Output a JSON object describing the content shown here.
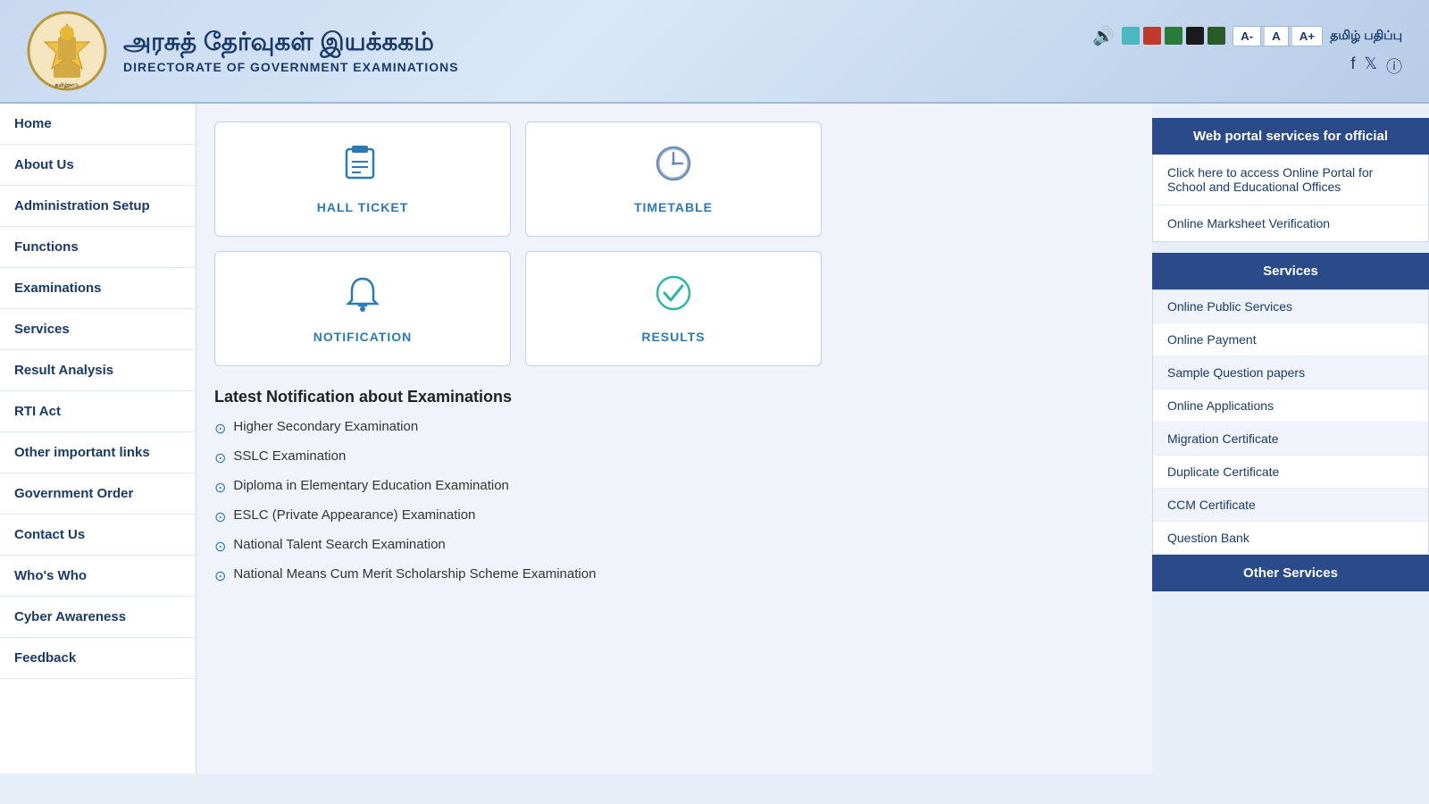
{
  "header": {
    "title_tamil": "அரசுத் தேர்வுகள் இயக்ககம்",
    "title_english": "DIRECTORATE OF GOVERNMENT EXAMINATIONS",
    "tamil_link": "தமிழ் பதிப்பு",
    "font_buttons": [
      "A-",
      "A",
      "A+"
    ]
  },
  "color_swatches": [
    {
      "color": "#4ab8c0",
      "label": "teal"
    },
    {
      "color": "#c0392b",
      "label": "red"
    },
    {
      "color": "#2a7a3a",
      "label": "green"
    },
    {
      "color": "#1a1a1a",
      "label": "black"
    },
    {
      "color": "#2a5a28",
      "label": "dark-green"
    }
  ],
  "sidebar": {
    "items": [
      {
        "label": "Home",
        "id": "home"
      },
      {
        "label": "About Us",
        "id": "about-us"
      },
      {
        "label": "Administration Setup",
        "id": "admin-setup"
      },
      {
        "label": "Functions",
        "id": "functions"
      },
      {
        "label": "Examinations",
        "id": "examinations"
      },
      {
        "label": "Services",
        "id": "services"
      },
      {
        "label": "Result Analysis",
        "id": "result-analysis"
      },
      {
        "label": "RTI Act",
        "id": "rti-act"
      },
      {
        "label": "Other important links",
        "id": "other-links"
      },
      {
        "label": "Government Order",
        "id": "govt-order"
      },
      {
        "label": "Contact Us",
        "id": "contact-us"
      },
      {
        "label": "Who's Who",
        "id": "whos-who"
      },
      {
        "label": "Cyber Awareness",
        "id": "cyber-awareness"
      },
      {
        "label": "Feedback",
        "id": "feedback"
      }
    ]
  },
  "quick_cards": [
    {
      "label": "HALL TICKET",
      "icon": "🪪",
      "id": "hall-ticket"
    },
    {
      "label": "TIMETABLE",
      "icon": "🕐",
      "id": "timetable"
    },
    {
      "label": "NOTIFICATION",
      "icon": "🔔",
      "id": "notification"
    },
    {
      "label": "RESULTS",
      "icon": "✅",
      "id": "results"
    }
  ],
  "notifications": {
    "heading": "Latest Notification about Examinations",
    "items": [
      {
        "text": "Higher Secondary Examination"
      },
      {
        "text": "SSLC Examination"
      },
      {
        "text": "Diploma in Elementary Education Examination"
      },
      {
        "text": "ESLC (Private Appearance) Examination"
      },
      {
        "text": "National Talent Search Examination"
      },
      {
        "text": "National Means Cum Merit Scholarship Scheme Examination"
      }
    ]
  },
  "right_panel": {
    "web_portal_header": "Web portal services for official",
    "web_portal_links": [
      {
        "text": "Click here to access Online Portal for School and Educational Offices"
      },
      {
        "text": "Online Marksheet Verification"
      }
    ],
    "services_header": "Services",
    "services": [
      {
        "text": "Online Public Services"
      },
      {
        "text": "Online Payment"
      },
      {
        "text": "Sample Question papers"
      },
      {
        "text": "Online Applications"
      },
      {
        "text": "Migration Certificate"
      },
      {
        "text": "Duplicate Certificate"
      },
      {
        "text": "CCM Certificate"
      },
      {
        "text": "Question Bank"
      }
    ],
    "other_services_header": "Other Services"
  }
}
